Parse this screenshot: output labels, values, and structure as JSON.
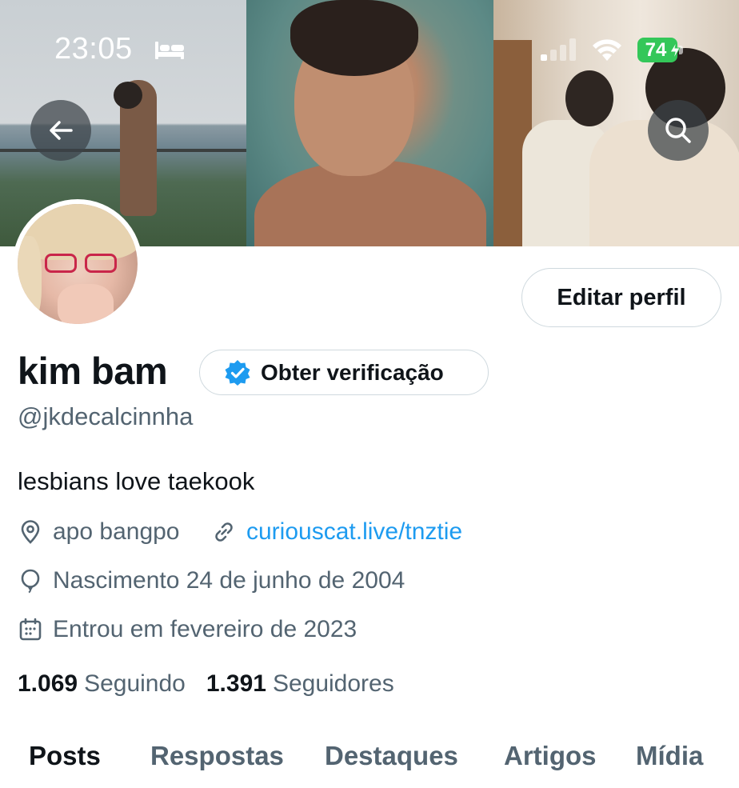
{
  "status_bar": {
    "time": "23:05",
    "battery": "74",
    "icons": [
      "bed-icon",
      "signal-icon",
      "wifi-icon",
      "battery-charging-icon"
    ]
  },
  "header": {
    "icons": [
      "back-arrow-icon",
      "search-icon"
    ]
  },
  "profile": {
    "name": "kim bam",
    "verify_label": "Obter verificação",
    "handle": "@jkdecalcinnha",
    "edit_label": "Editar perfil",
    "bio": "lesbians love taekook",
    "location": "apo bangpo",
    "link": "curiouscat.live/tnztie",
    "birth": "Nascimento 24 de junho de 2004",
    "joined": "Entrou em fevereiro de 2023"
  },
  "stats": {
    "following_count": "1.069",
    "following_label": "Seguindo",
    "followers_count": "1.391",
    "followers_label": "Seguidores"
  },
  "tabs": [
    {
      "label": "Posts",
      "active": true
    },
    {
      "label": "Respostas",
      "active": false
    },
    {
      "label": "Destaques",
      "active": false
    },
    {
      "label": "Artigos",
      "active": false
    },
    {
      "label": "Mídia",
      "active": false
    }
  ],
  "colors": {
    "text_primary": "#0f1419",
    "text_secondary": "#536471",
    "link": "#1d9bf0",
    "verified_badge": "#1d9bf0",
    "battery": "#34c759",
    "border": "#cfd9de"
  }
}
